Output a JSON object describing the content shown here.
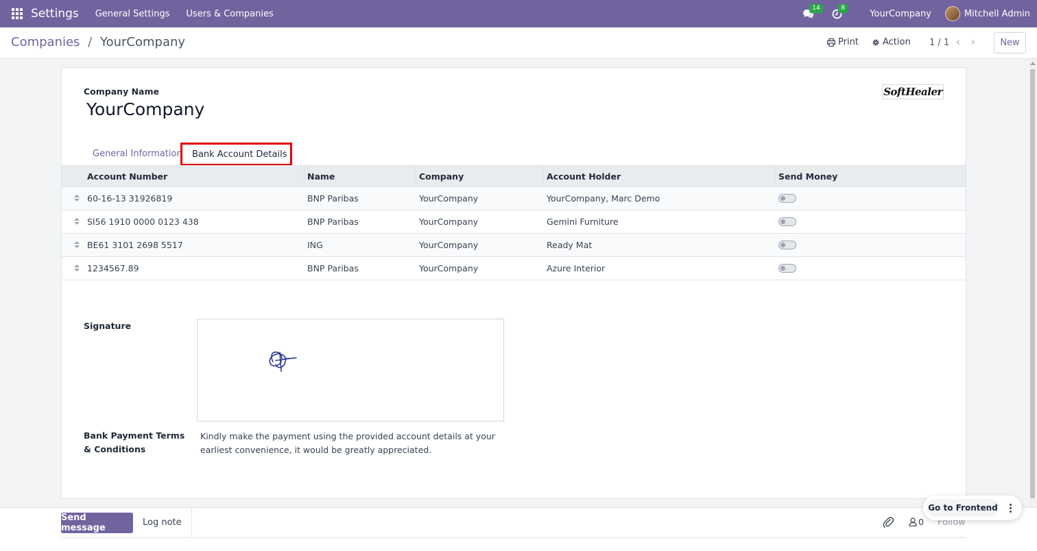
{
  "navbar": {
    "app_name": "Settings",
    "menus": [
      "General Settings",
      "Users & Companies"
    ],
    "messages_badge": "14",
    "activities_badge": "8",
    "company": "YourCompany",
    "user": "Mitchell Admin",
    "color": "#71639e"
  },
  "control_panel": {
    "breadcrumb_parent": "Companies",
    "breadcrumb_sep": "/",
    "breadcrumb_current": "YourCompany",
    "print_label": "Print",
    "action_label": "Action",
    "pager": "1 / 1",
    "new_label": "New"
  },
  "form": {
    "company_name_label": "Company Name",
    "company_name": "YourCompany",
    "logo_text": "SoftHealer",
    "tabs": [
      "General Information",
      "Bank Account Details"
    ],
    "active_tab": "Bank Account Details",
    "table": {
      "columns": [
        "Account Number",
        "Name",
        "Company",
        "Account Holder",
        "Send Money"
      ],
      "rows": [
        {
          "account_number": "60-16-13 31926819",
          "name": "BNP Paribas",
          "company": "YourCompany",
          "holder": "YourCompany, Marc Demo",
          "send_money": false
        },
        {
          "account_number": "SI56 1910 0000 0123 438",
          "name": "BNP Paribas",
          "company": "YourCompany",
          "holder": "Gemini Furniture",
          "send_money": false
        },
        {
          "account_number": "BE61 3101 2698 5517",
          "name": "ING",
          "company": "YourCompany",
          "holder": "Ready Mat",
          "send_money": false
        },
        {
          "account_number": "1234567.89",
          "name": "BNP Paribas",
          "company": "YourCompany",
          "holder": "Azure Interior",
          "send_money": false
        }
      ]
    },
    "signature_label": "Signature",
    "terms_label": "Bank Payment Terms & Conditions",
    "terms_text": "Kindly make the payment using the provided account details at your earliest convenience, it would be greatly appreciated."
  },
  "chatter": {
    "send_message": "Send message",
    "log_note": "Log note",
    "followers_count": "0",
    "follow": "Follow"
  },
  "frontend": {
    "label": "Go to Frontend"
  },
  "colors": {
    "brand": "#71639e",
    "highlight": "#e00000",
    "badge": "#28a745"
  }
}
